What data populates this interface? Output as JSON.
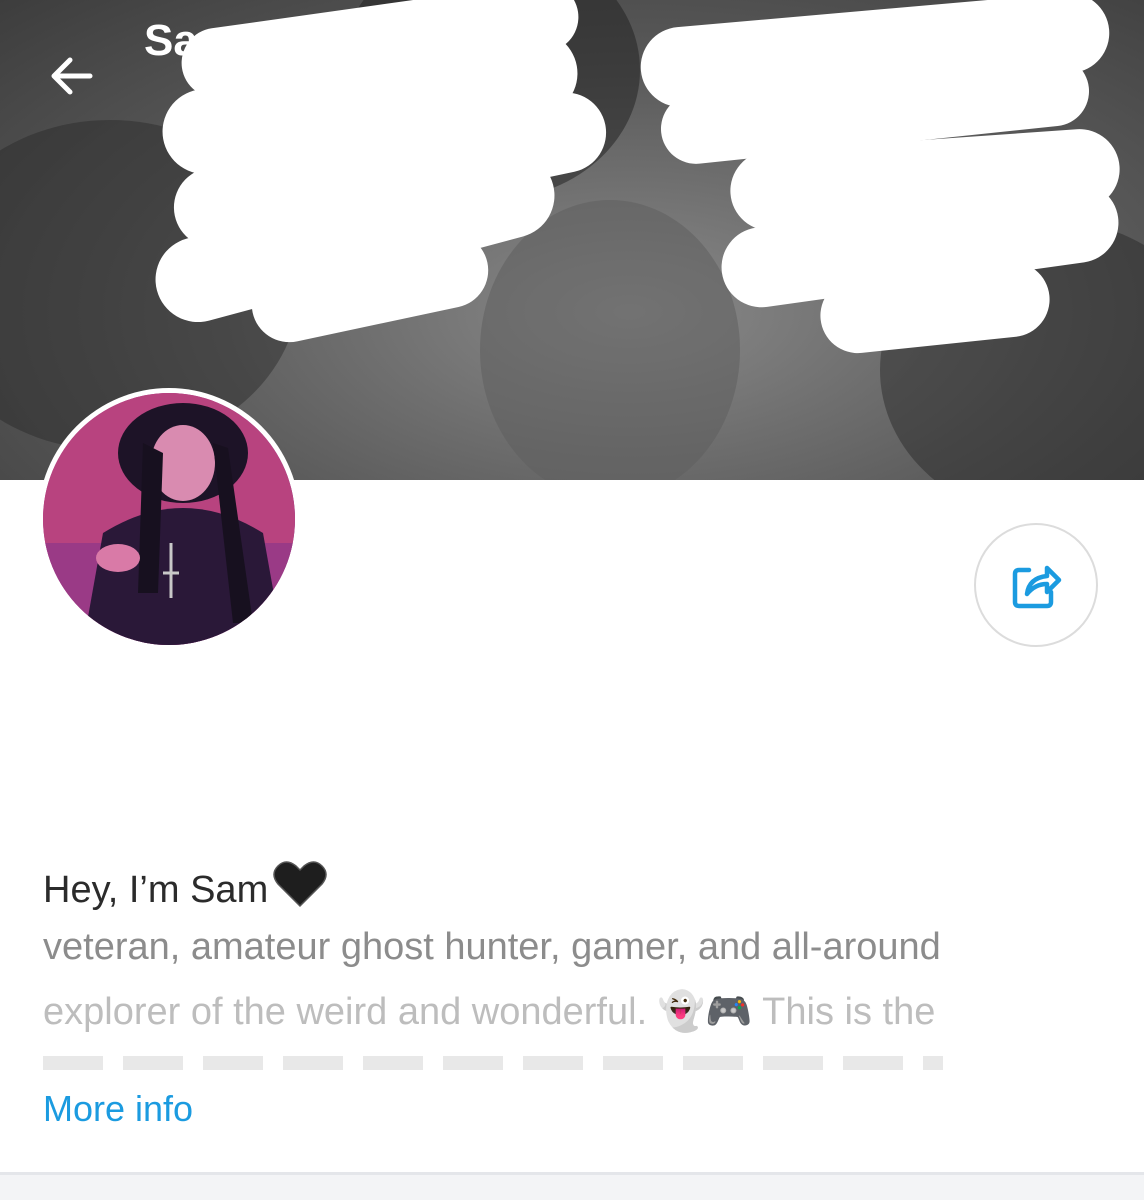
{
  "header": {
    "title_partial": "Sa",
    "back_icon": "arrow-left-icon",
    "background_style": "grayscale photo, partially redacted"
  },
  "profile": {
    "avatar_desc": "profile photo",
    "share_icon": "share-icon"
  },
  "bio": {
    "name_line": "Hey, I’m Sam",
    "heart_emoji": "🖤",
    "line1": "veteran, amateur ghost hunter, gamer, and all-around",
    "line2": "explorer of the weird and wonderful. 👻🎮 This is the"
  },
  "actions": {
    "more_info": "More info"
  },
  "colors": {
    "link": "#1b9be0",
    "primary_text": "#2b2b2b",
    "secondary_text": "#8c8c8c"
  }
}
